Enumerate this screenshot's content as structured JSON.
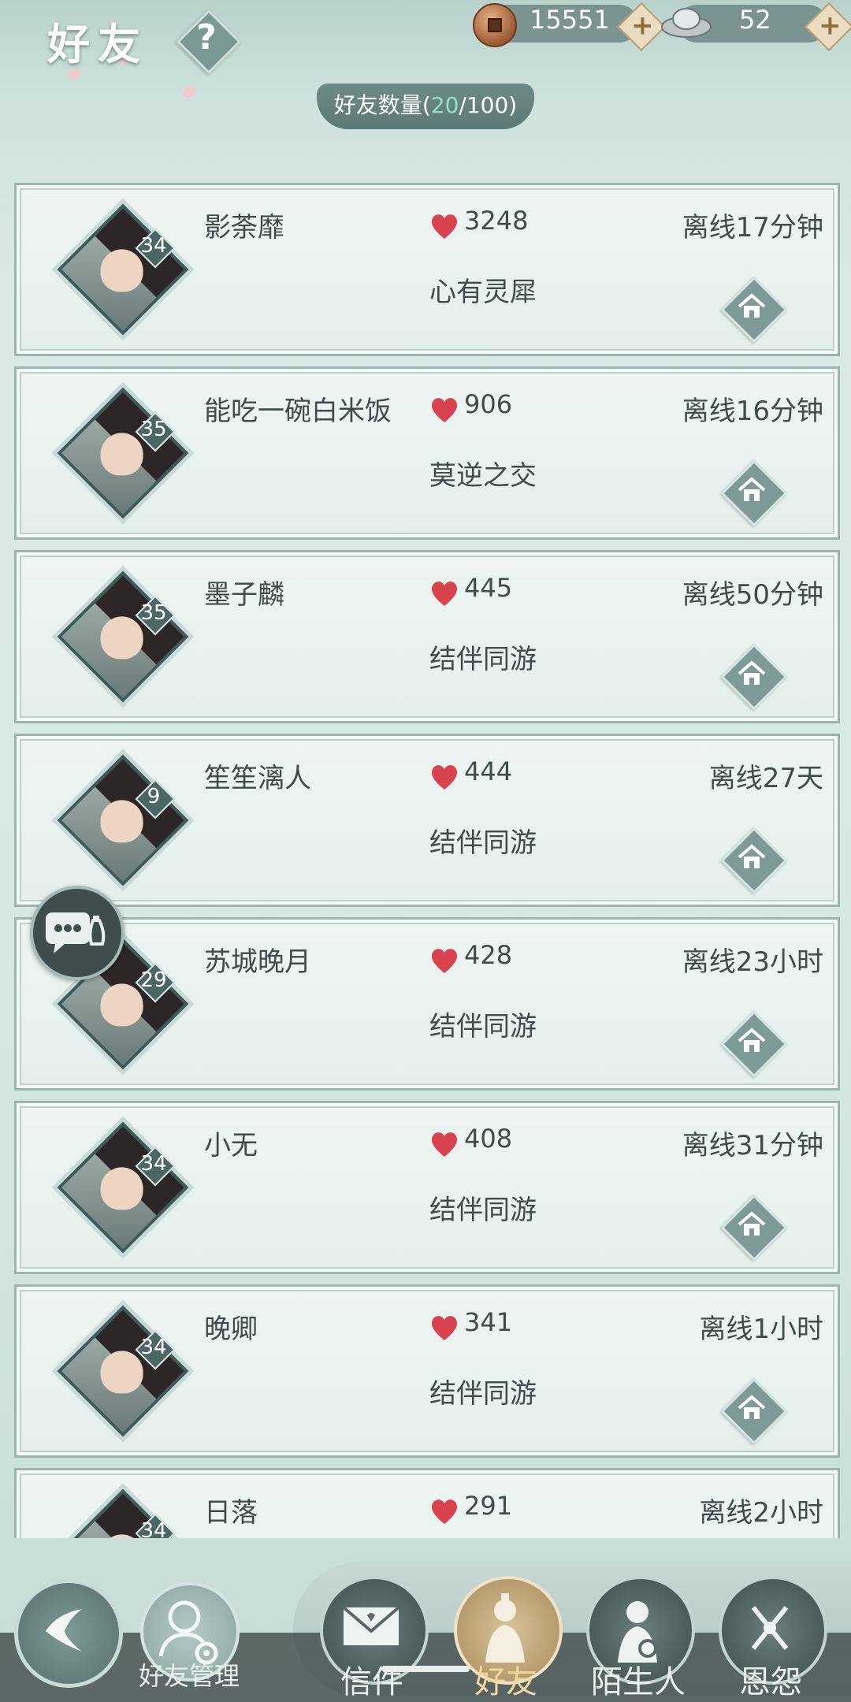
{
  "header": {
    "title": "好友",
    "help_label": "?",
    "copper": "15551",
    "silver": "52",
    "friend_count_label": "好友数量",
    "friend_count_open": "(",
    "friend_count_current": "20",
    "friend_count_total": "/100)"
  },
  "friends": [
    {
      "name": "影荼靡",
      "level": "34",
      "score": "3248",
      "relation": "心有灵犀",
      "status": "离线17分钟"
    },
    {
      "name": "能吃一碗白米饭",
      "level": "35",
      "score": "906",
      "relation": "莫逆之交",
      "status": "离线16分钟"
    },
    {
      "name": "墨子麟",
      "level": "35",
      "score": "445",
      "relation": "结伴同游",
      "status": "离线50分钟"
    },
    {
      "name": "笙笙漓人",
      "level": "9",
      "score": "444",
      "relation": "结伴同游",
      "status": "离线27天"
    },
    {
      "name": "苏城晚月",
      "level": "29",
      "score": "428",
      "relation": "结伴同游",
      "status": "离线23小时"
    },
    {
      "name": "小无",
      "level": "34",
      "score": "408",
      "relation": "结伴同游",
      "status": "离线31分钟"
    },
    {
      "name": "晚卿",
      "level": "34",
      "score": "341",
      "relation": "结伴同游",
      "status": "离线1小时"
    },
    {
      "name": "日落",
      "level": "34",
      "score": "291",
      "relation": "",
      "status": "离线2小时"
    }
  ],
  "bottom": {
    "manage_label": "好友管理",
    "tabs": [
      {
        "label": "信件"
      },
      {
        "label": "好友"
      },
      {
        "label": "陌生人"
      },
      {
        "label": "恩怨"
      }
    ],
    "active_tab": "好友"
  },
  "colors": {
    "accent_count": "#8ee2c9",
    "heart": "#d9424f",
    "card_border": "#9cb5b1"
  }
}
